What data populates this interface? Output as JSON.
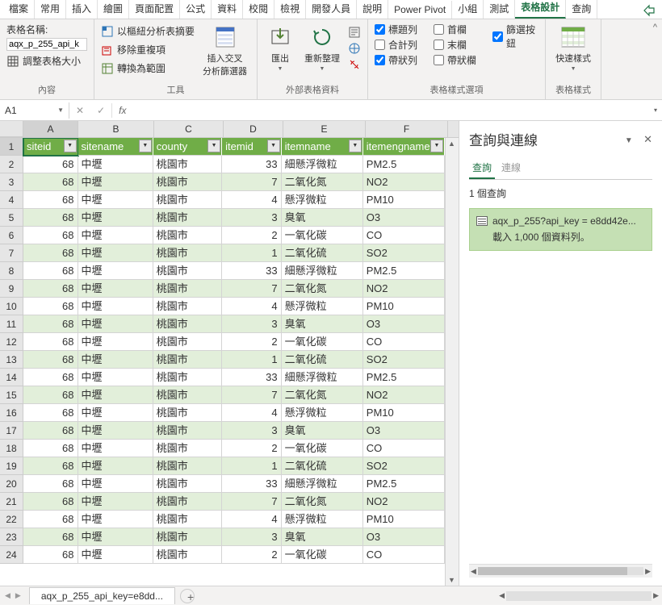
{
  "ribbon_tabs": [
    "檔案",
    "常用",
    "插入",
    "繪圖",
    "頁面配置",
    "公式",
    "資料",
    "校閱",
    "檢視",
    "開發人員",
    "說明",
    "Power Pivot",
    "小組",
    "測試",
    "表格設計",
    "查詢"
  ],
  "ribbon_active_tab": "表格設計",
  "table_name_label": "表格名稱:",
  "table_name_value": "aqx_p_255_api_k",
  "resize_table": "調整表格大小",
  "group_content": "內容",
  "pivot_summary": "以樞紐分析表摘要",
  "remove_dup": "移除重複項",
  "convert_range": "轉換為範圍",
  "group_tools": "工具",
  "insert_slicer": "插入交叉\n分析篩選器",
  "export": "匯出",
  "refresh": "重新整理",
  "group_external": "外部表格資料",
  "header_row": "標題列",
  "total_row": "合計列",
  "banded_rows": "帶狀列",
  "first_col": "首欄",
  "last_col": "末欄",
  "banded_cols": "帶狀欄",
  "filter_btn": "篩選按鈕",
  "group_style_opts": "表格樣式選項",
  "quick_styles": "快速樣式",
  "group_styles": "表格樣式",
  "name_box": "A1",
  "col_letters": [
    "A",
    "B",
    "C",
    "D",
    "E",
    "F"
  ],
  "table_headers": [
    "siteid",
    "sitename",
    "county",
    "itemid",
    "itemname",
    "itemengname"
  ],
  "rows": [
    [
      68,
      "中壢",
      "桃園市",
      33,
      "細懸浮微粒",
      "PM2.5"
    ],
    [
      68,
      "中壢",
      "桃園市",
      7,
      "二氧化氮",
      "NO2"
    ],
    [
      68,
      "中壢",
      "桃園市",
      4,
      "懸浮微粒",
      "PM10"
    ],
    [
      68,
      "中壢",
      "桃園市",
      3,
      "臭氧",
      "O3"
    ],
    [
      68,
      "中壢",
      "桃園市",
      2,
      "一氧化碳",
      "CO"
    ],
    [
      68,
      "中壢",
      "桃園市",
      1,
      "二氧化硫",
      "SO2"
    ],
    [
      68,
      "中壢",
      "桃園市",
      33,
      "細懸浮微粒",
      "PM2.5"
    ],
    [
      68,
      "中壢",
      "桃園市",
      7,
      "二氧化氮",
      "NO2"
    ],
    [
      68,
      "中壢",
      "桃園市",
      4,
      "懸浮微粒",
      "PM10"
    ],
    [
      68,
      "中壢",
      "桃園市",
      3,
      "臭氧",
      "O3"
    ],
    [
      68,
      "中壢",
      "桃園市",
      2,
      "一氧化碳",
      "CO"
    ],
    [
      68,
      "中壢",
      "桃園市",
      1,
      "二氧化硫",
      "SO2"
    ],
    [
      68,
      "中壢",
      "桃園市",
      33,
      "細懸浮微粒",
      "PM2.5"
    ],
    [
      68,
      "中壢",
      "桃園市",
      7,
      "二氧化氮",
      "NO2"
    ],
    [
      68,
      "中壢",
      "桃園市",
      4,
      "懸浮微粒",
      "PM10"
    ],
    [
      68,
      "中壢",
      "桃園市",
      3,
      "臭氧",
      "O3"
    ],
    [
      68,
      "中壢",
      "桃園市",
      2,
      "一氧化碳",
      "CO"
    ],
    [
      68,
      "中壢",
      "桃園市",
      1,
      "二氧化硫",
      "SO2"
    ],
    [
      68,
      "中壢",
      "桃園市",
      33,
      "細懸浮微粒",
      "PM2.5"
    ],
    [
      68,
      "中壢",
      "桃園市",
      7,
      "二氧化氮",
      "NO2"
    ],
    [
      68,
      "中壢",
      "桃園市",
      4,
      "懸浮微粒",
      "PM10"
    ],
    [
      68,
      "中壢",
      "桃園市",
      3,
      "臭氧",
      "O3"
    ],
    [
      68,
      "中壢",
      "桃園市",
      2,
      "一氧化碳",
      "CO"
    ]
  ],
  "panel_title": "查詢與連線",
  "panel_tab_queries": "查詢",
  "panel_tab_connections": "連線",
  "panel_count": "1 個查詢",
  "query_name": "aqx_p_255?api_key = e8dd42e...",
  "query_status": "載入 1,000 個資料列。",
  "sheet_tab": "aqx_p_255_api_key=e8dd..."
}
